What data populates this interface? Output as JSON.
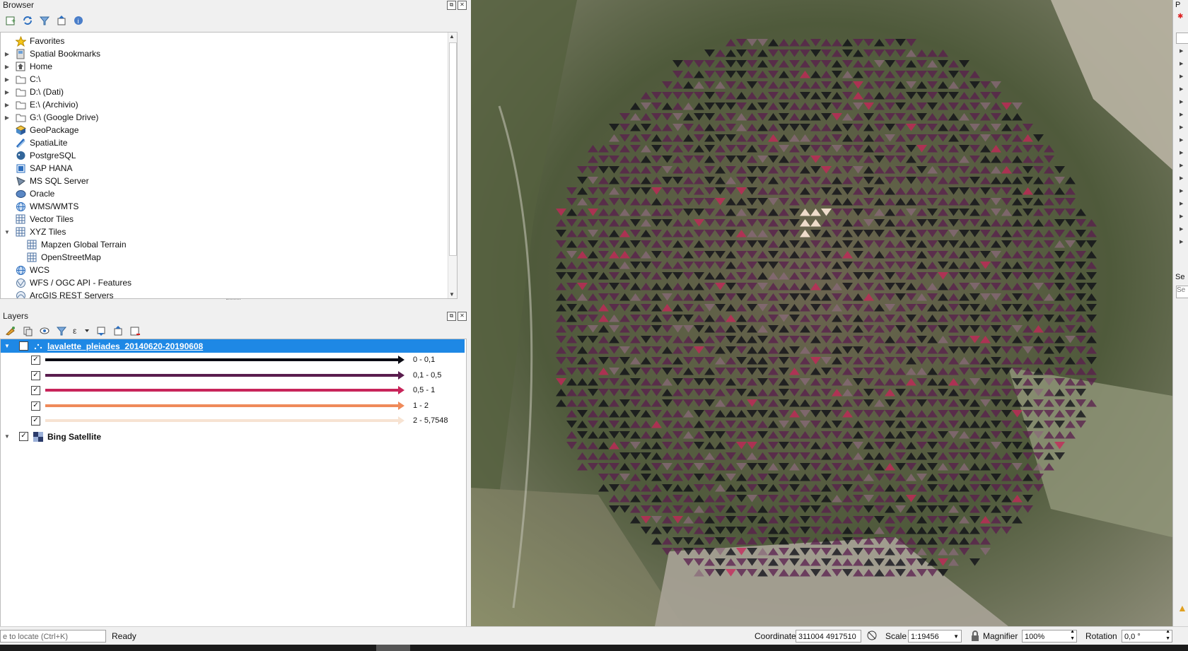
{
  "browser": {
    "title": "Browser",
    "items": [
      {
        "label": "Favorites",
        "icon": "star-icon",
        "arrow": ""
      },
      {
        "label": "Spatial Bookmarks",
        "icon": "bookmark-icon",
        "arrow": "▶"
      },
      {
        "label": "Home",
        "icon": "home-icon",
        "arrow": "▶"
      },
      {
        "label": "C:\\",
        "icon": "folder-icon",
        "arrow": "▶"
      },
      {
        "label": "D:\\ (Dati)",
        "icon": "folder-icon",
        "arrow": "▶"
      },
      {
        "label": "E:\\ (Archivio)",
        "icon": "folder-icon",
        "arrow": "▶"
      },
      {
        "label": "G:\\ (Google Drive)",
        "icon": "folder-icon",
        "arrow": "▶"
      },
      {
        "label": "GeoPackage",
        "icon": "geopackage-icon",
        "arrow": ""
      },
      {
        "label": "SpatiaLite",
        "icon": "spatialite-icon",
        "arrow": ""
      },
      {
        "label": "PostgreSQL",
        "icon": "postgresql-icon",
        "arrow": ""
      },
      {
        "label": "SAP HANA",
        "icon": "saphana-icon",
        "arrow": ""
      },
      {
        "label": "MS SQL Server",
        "icon": "mssql-icon",
        "arrow": ""
      },
      {
        "label": "Oracle",
        "icon": "oracle-icon",
        "arrow": ""
      },
      {
        "label": "WMS/WMTS",
        "icon": "globe-icon",
        "arrow": ""
      },
      {
        "label": "Vector Tiles",
        "icon": "grid-icon",
        "arrow": ""
      },
      {
        "label": "XYZ Tiles",
        "icon": "grid-icon",
        "arrow": "▼"
      },
      {
        "label": "Mapzen Global Terrain",
        "icon": "grid-icon",
        "arrow": "",
        "indent": 1
      },
      {
        "label": "OpenStreetMap",
        "icon": "grid-icon",
        "arrow": "",
        "indent": 1
      },
      {
        "label": "WCS",
        "icon": "globe-icon",
        "arrow": ""
      },
      {
        "label": "WFS / OGC API - Features",
        "icon": "wfs-icon",
        "arrow": ""
      },
      {
        "label": "ArcGIS REST Servers",
        "icon": "arcgis-icon",
        "arrow": ""
      }
    ]
  },
  "layers": {
    "title": "Layers",
    "layer1": {
      "name": "lavalette_pleiades_20140620-20190608"
    },
    "legend": [
      {
        "label": "0 - 0,1",
        "color": "#0b0b14"
      },
      {
        "label": "0,1 - 0,5",
        "color": "#5a1d4e"
      },
      {
        "label": "0,5 - 1",
        "color": "#c8245a"
      },
      {
        "label": "1 - 2",
        "color": "#ef8a5a"
      },
      {
        "label": "2 - 5,7548",
        "color": "#f7e3d2"
      }
    ],
    "layer2": {
      "name": "Bing Satellite"
    }
  },
  "status": {
    "locate_placeholder": "e to locate (Ctrl+K)",
    "ready": "Ready",
    "coordinate_label": "Coordinate",
    "coordinate_value": "311004 4917510",
    "scale_label": "Scale",
    "scale_value": "1:19456",
    "magnifier_label": "Magnifier",
    "magnifier_value": "100%",
    "rotation_label": "Rotation",
    "rotation_value": "0,0 °"
  },
  "right_dock": {
    "title_fragment": "P",
    "label_fragment": "Se",
    "input_fragment": "Se"
  }
}
